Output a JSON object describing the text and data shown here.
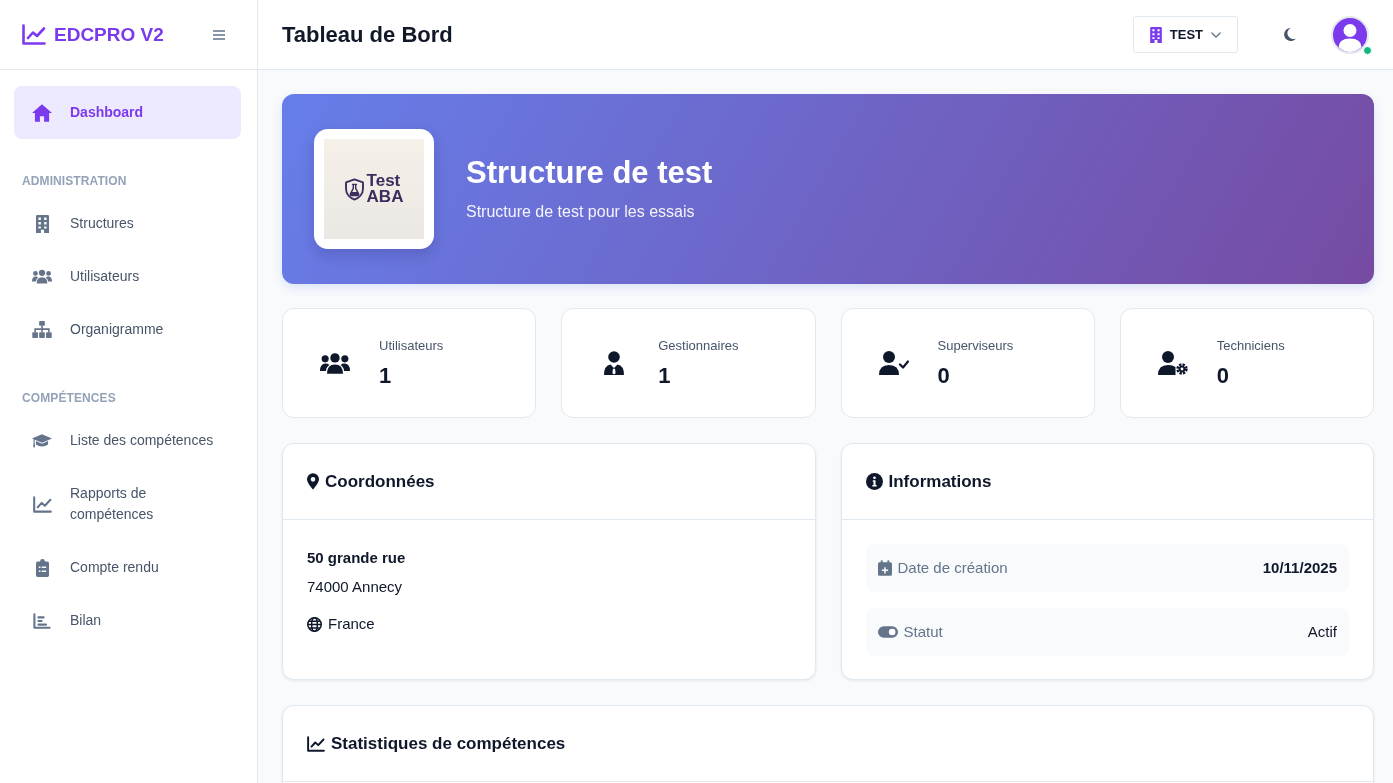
{
  "sidebar": {
    "brand": "EDCPRO V2",
    "sections": [
      {
        "items": [
          {
            "label": "Dashboard",
            "selected": true
          }
        ]
      },
      {
        "heading": "ADMINISTRATION",
        "items": [
          {
            "label": "Structures",
            "selected": false
          },
          {
            "label": "Utilisateurs",
            "selected": false
          },
          {
            "label": "Organigramme",
            "selected": false
          }
        ]
      },
      {
        "heading": "COMPÉTENCES",
        "items": [
          {
            "label": "Liste des compétences",
            "selected": false
          },
          {
            "label": "Rapports de compétences",
            "selected": false
          },
          {
            "label": "Compte rendu",
            "selected": false
          },
          {
            "label": "Bilan",
            "selected": false
          }
        ]
      }
    ]
  },
  "header": {
    "title": "Tableau de Bord",
    "structure_selector": "TEST",
    "user": {
      "online": true
    }
  },
  "hero": {
    "logo_lines": [
      "Test",
      "ABA"
    ],
    "title": "Structure de test",
    "subtitle": "Structure de test pour les essais"
  },
  "stats": [
    {
      "label": "Utilisateurs",
      "value": "1"
    },
    {
      "label": "Gestionnaires",
      "value": "1"
    },
    {
      "label": "Superviseurs",
      "value": "0"
    },
    {
      "label": "Techniciens",
      "value": "0"
    }
  ],
  "address_card": {
    "title": "Coordonnées",
    "street": "50 grande rue",
    "city": "74000 Annecy",
    "country": "France"
  },
  "info_card": {
    "title": "Informations",
    "rows": [
      {
        "kind": "date",
        "label": "Date de création",
        "value": "10/11/2025"
      },
      {
        "kind": "status",
        "label": "Statut",
        "value": "Actif"
      }
    ]
  },
  "stats_card": {
    "title": "Statistiques de compétences"
  }
}
